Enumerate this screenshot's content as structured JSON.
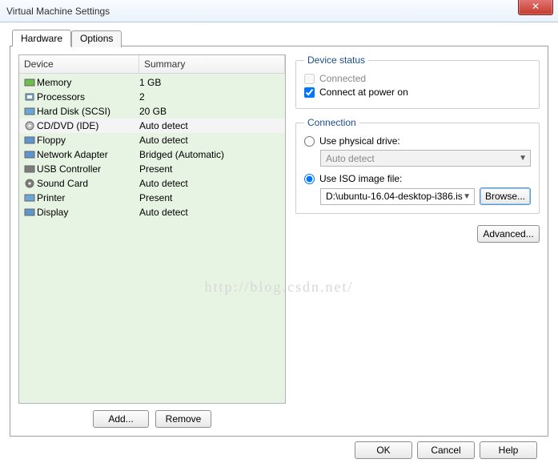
{
  "window": {
    "title": "Virtual Machine Settings",
    "close_glyph": "✕"
  },
  "tabs": {
    "hardware": "Hardware",
    "options": "Options"
  },
  "device_list": {
    "header_device": "Device",
    "header_summary": "Summary",
    "items": [
      {
        "icon": "memory-icon",
        "name": "Memory",
        "summary": "1 GB"
      },
      {
        "icon": "cpu-icon",
        "name": "Processors",
        "summary": "2"
      },
      {
        "icon": "hdd-icon",
        "name": "Hard Disk (SCSI)",
        "summary": "20 GB"
      },
      {
        "icon": "cd-icon",
        "name": "CD/DVD (IDE)",
        "summary": "Auto detect",
        "selected": true
      },
      {
        "icon": "floppy-icon",
        "name": "Floppy",
        "summary": "Auto detect"
      },
      {
        "icon": "network-icon",
        "name": "Network Adapter",
        "summary": "Bridged (Automatic)"
      },
      {
        "icon": "usb-icon",
        "name": "USB Controller",
        "summary": "Present"
      },
      {
        "icon": "sound-icon",
        "name": "Sound Card",
        "summary": "Auto detect"
      },
      {
        "icon": "printer-icon",
        "name": "Printer",
        "summary": "Present"
      },
      {
        "icon": "display-icon",
        "name": "Display",
        "summary": "Auto detect"
      }
    ],
    "add_label": "Add...",
    "remove_label": "Remove"
  },
  "device_status": {
    "legend": "Device status",
    "connected": "Connected",
    "connected_checked": false,
    "connect_power": "Connect at power on",
    "connect_power_checked": true
  },
  "connection": {
    "legend": "Connection",
    "use_physical": "Use physical drive:",
    "physical_value": "Auto detect",
    "use_iso": "Use ISO image file:",
    "iso_path": "D:\\ubuntu-16.04-desktop-i386.is",
    "browse": "Browse..."
  },
  "advanced_label": "Advanced...",
  "footer": {
    "ok": "OK",
    "cancel": "Cancel",
    "help": "Help"
  },
  "watermark": "http://blog.csdn.net/",
  "icons": {
    "memory-icon": {
      "fill": "#6bbf4a",
      "shape": "rect"
    },
    "cpu-icon": {
      "fill": "#6aa6d8",
      "shape": "chip"
    },
    "hdd-icon": {
      "fill": "#6aa6d8",
      "shape": "rect"
    },
    "cd-icon": {
      "fill": "#bdbdbd",
      "shape": "disc"
    },
    "floppy-icon": {
      "fill": "#5f95cf",
      "shape": "rect"
    },
    "network-icon": {
      "fill": "#5f95cf",
      "shape": "rect"
    },
    "usb-icon": {
      "fill": "#7c7c7c",
      "shape": "rect"
    },
    "sound-icon": {
      "fill": "#7c7c7c",
      "shape": "disc"
    },
    "printer-icon": {
      "fill": "#6aa6d8",
      "shape": "rect"
    },
    "display-icon": {
      "fill": "#5f95cf",
      "shape": "rect"
    }
  }
}
